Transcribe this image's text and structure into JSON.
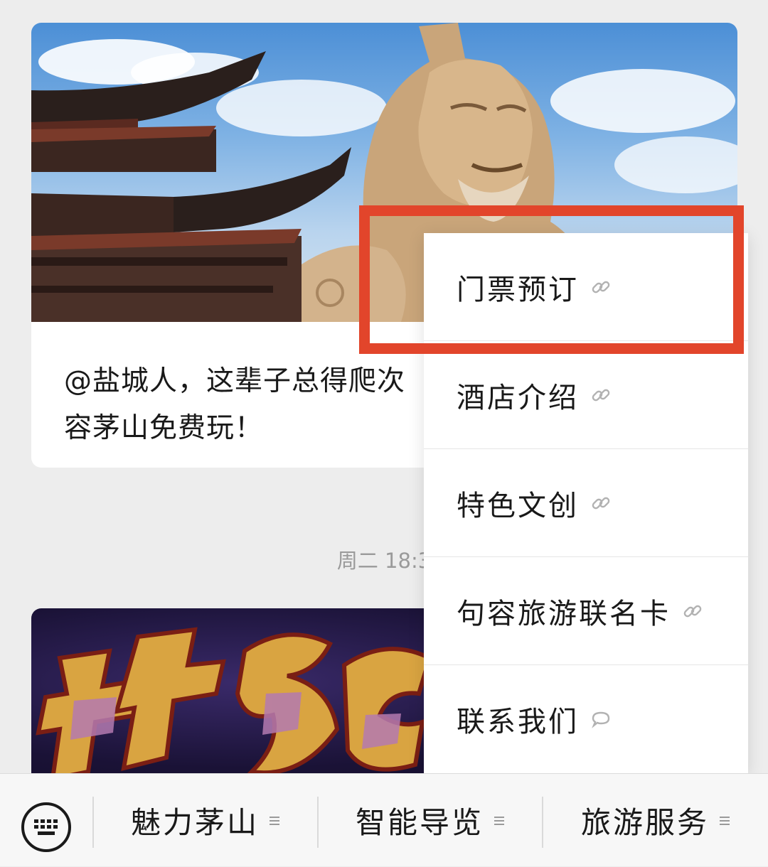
{
  "articles": [
    {
      "title": "@盐城人，这辈子总得爬次\n容茅山免费玩！"
    }
  ],
  "time_label": "周二 18:3",
  "popup_menu": {
    "items": [
      {
        "label": "门票预订",
        "icon": "link-icon"
      },
      {
        "label": "酒店介绍",
        "icon": "link-icon"
      },
      {
        "label": "特色文创",
        "icon": "link-icon"
      },
      {
        "label": "句容旅游联名卡",
        "icon": "link-icon"
      },
      {
        "label": "联系我们",
        "icon": "chat-bubble-icon"
      }
    ],
    "highlighted_index": 0,
    "highlight_color": "#e2452b"
  },
  "bottom_bar": {
    "keyboard_icon": "keyboard-icon",
    "tabs": [
      {
        "label": "魅力茅山",
        "icon": "menu-lines-icon"
      },
      {
        "label": "智能导览",
        "icon": "menu-lines-icon"
      },
      {
        "label": "旅游服务",
        "icon": "menu-lines-icon"
      }
    ]
  }
}
